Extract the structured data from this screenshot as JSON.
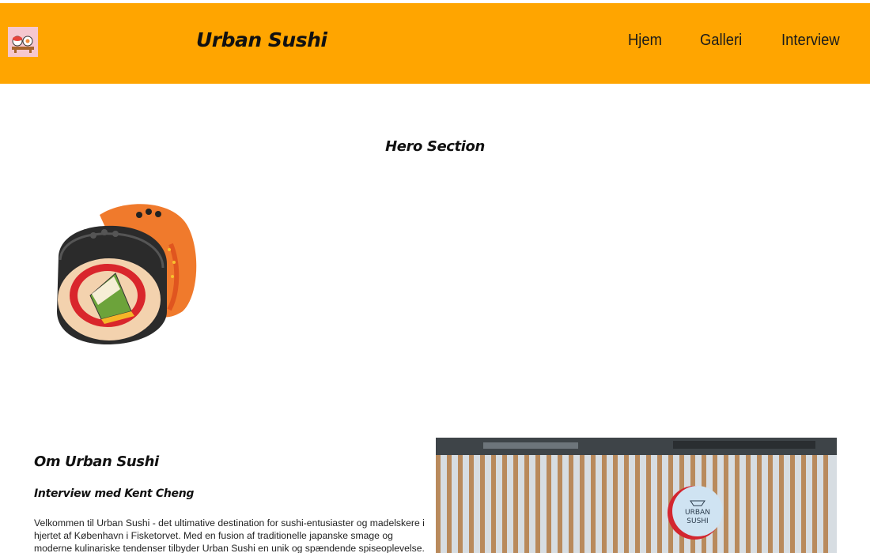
{
  "header": {
    "logo_icon": "sushi-logo-icon",
    "site_title": "Urban Sushi",
    "background_color": "#FFA500",
    "nav": [
      {
        "label": "Hjem"
      },
      {
        "label": "Galleri"
      },
      {
        "label": "Interview"
      }
    ]
  },
  "hero": {
    "title": "Hero Section",
    "image_icon": "sushi-roll-illustration"
  },
  "about": {
    "heading": "Om Urban Sushi",
    "subheading": "Interview med Kent Cheng",
    "body": "Velkommen til Urban Sushi - det ultimative destination for sushi-entusiaster og madelskere i hjertet af København i Fisketorvet. Med en fusion af traditionelle japanske smage og moderne kulinariske tendenser tilbyder Urban Sushi en unik og spændende spiseoplevelse. Uanset om",
    "photo_sign_line1": "URBAN",
    "photo_sign_line2": "SUSHI"
  }
}
